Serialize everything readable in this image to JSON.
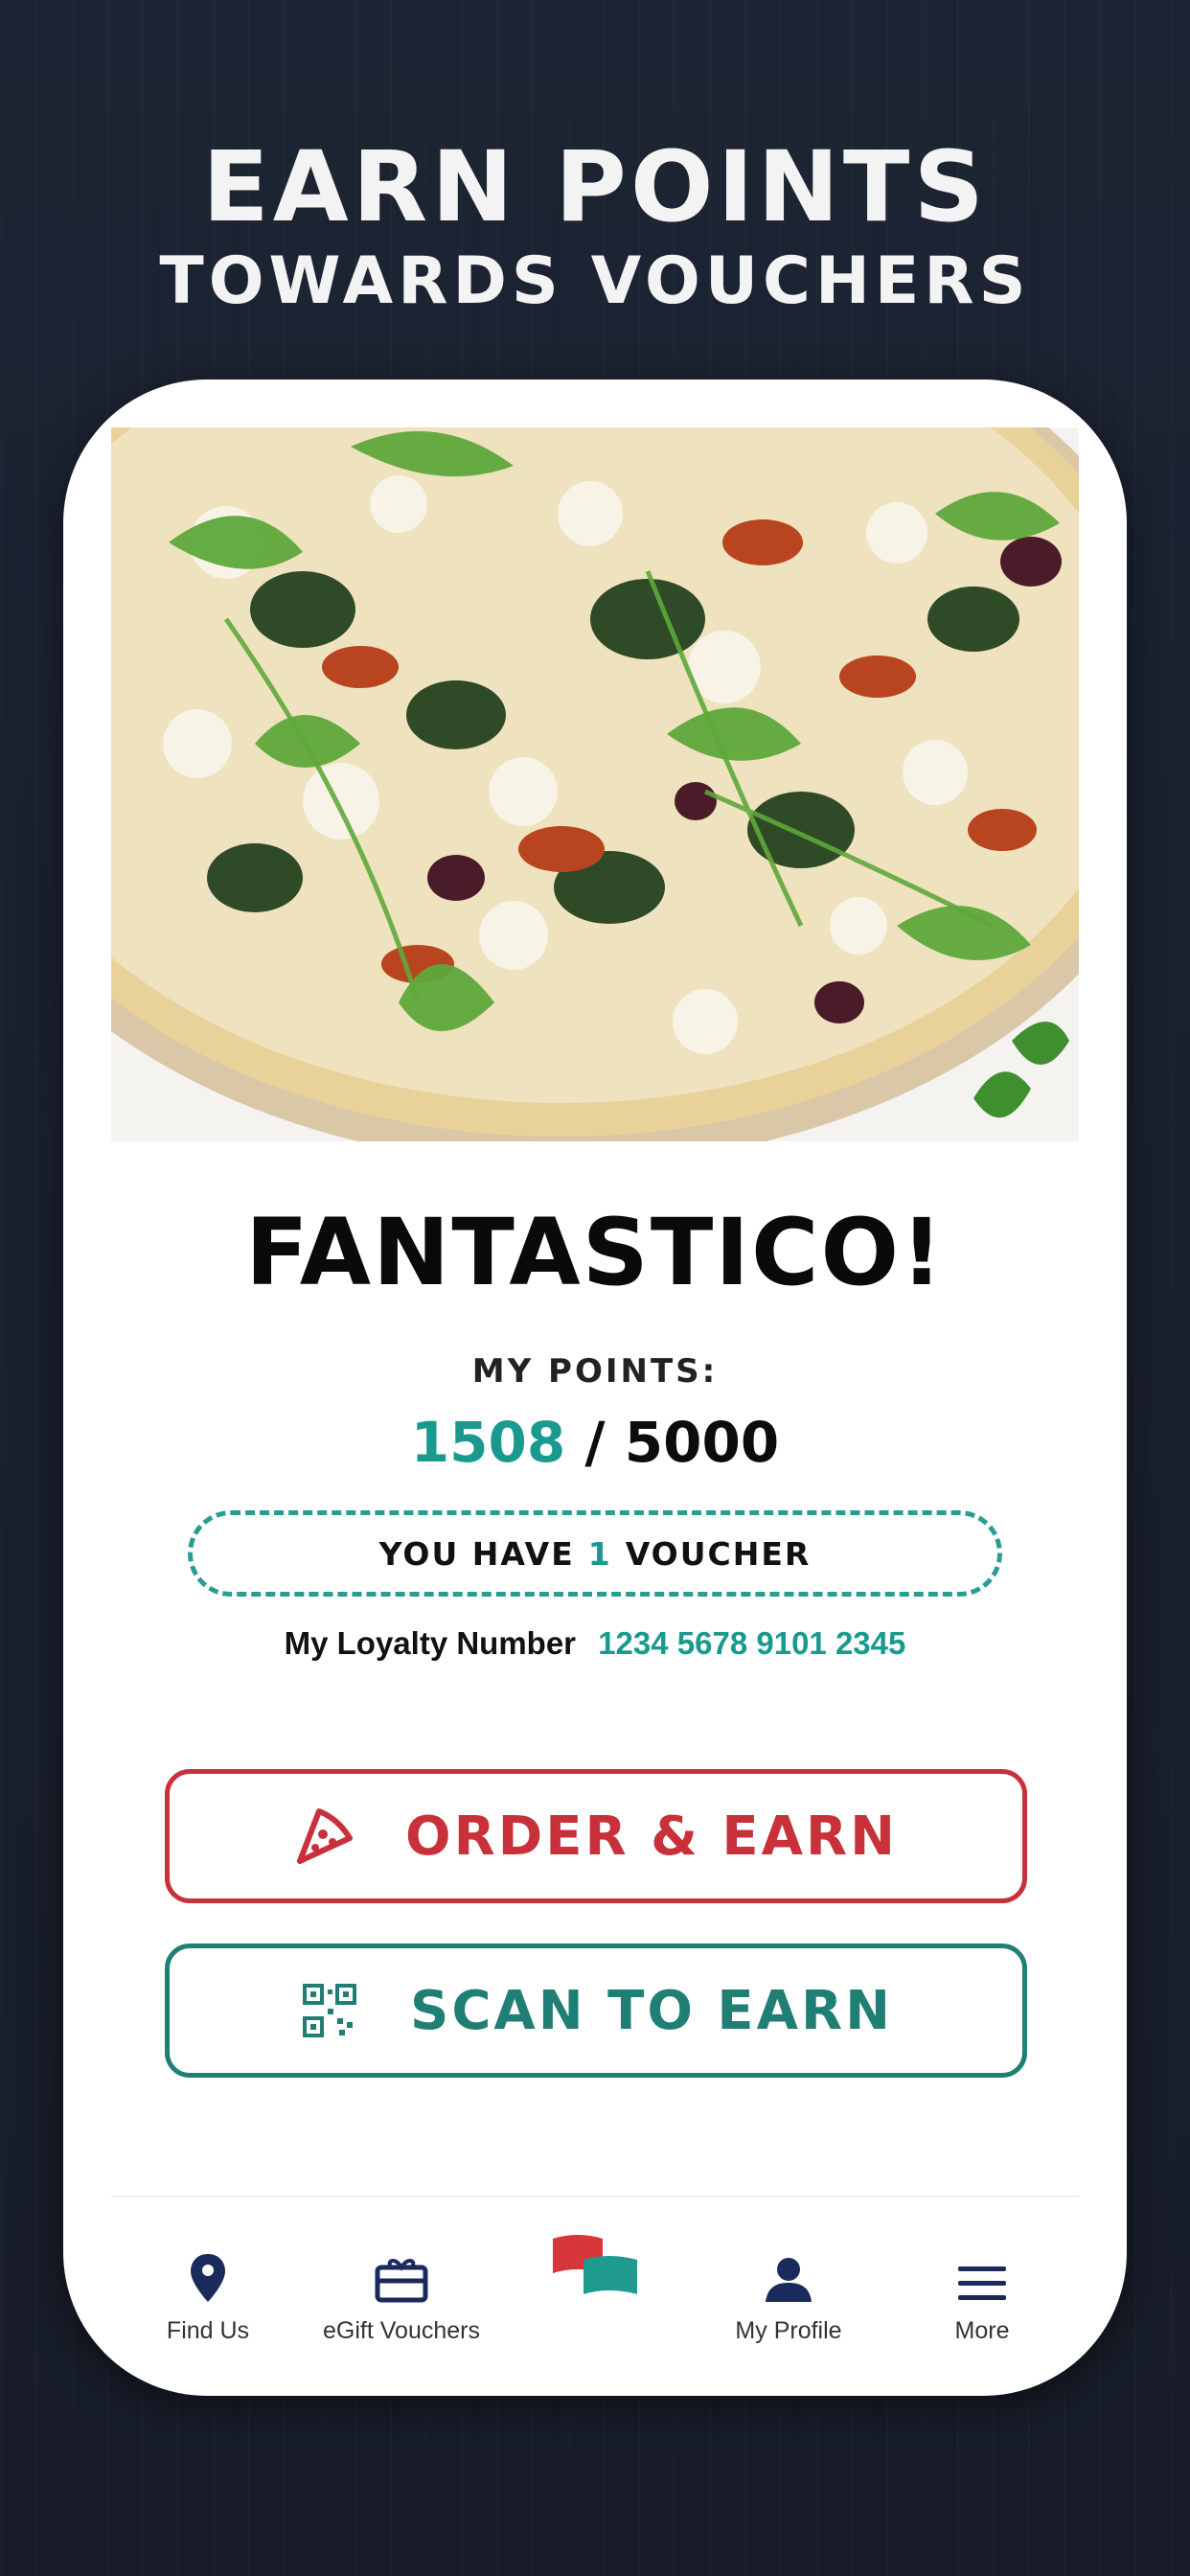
{
  "headline": {
    "line1": "EARN POINTS",
    "line2": "TOWARDS VOUCHERS"
  },
  "hero": {
    "icon": "pizza-photo"
  },
  "card": {
    "title": "FANTASTICO!",
    "points_label": "MY POINTS:",
    "points_current": "1508",
    "points_separator": "/",
    "points_total": "5000",
    "voucher_prefix": "YOU HAVE",
    "voucher_count": "1",
    "voucher_suffix": "VOUCHER",
    "loyalty_label": "My Loyalty Number",
    "loyalty_number": "1234 5678 9101 2345"
  },
  "actions": {
    "order": {
      "label": "ORDER & EARN",
      "icon": "pizza-slice-icon",
      "color": "#c8313a"
    },
    "scan": {
      "label": "SCAN TO EARN",
      "icon": "qr-code-icon",
      "color": "#207f74"
    }
  },
  "tabs": [
    {
      "label": "Find Us",
      "icon": "location-pin-icon"
    },
    {
      "label": "eGift Vouchers",
      "icon": "gift-card-icon"
    },
    {
      "label": "",
      "icon": "flags-logo-icon"
    },
    {
      "label": "My Profile",
      "icon": "person-icon"
    },
    {
      "label": "More",
      "icon": "menu-icon"
    }
  ],
  "colors": {
    "navy": "#1b2a5c",
    "teal": "#1a9a8f",
    "red": "#c8313a",
    "background": "#1b2130"
  }
}
